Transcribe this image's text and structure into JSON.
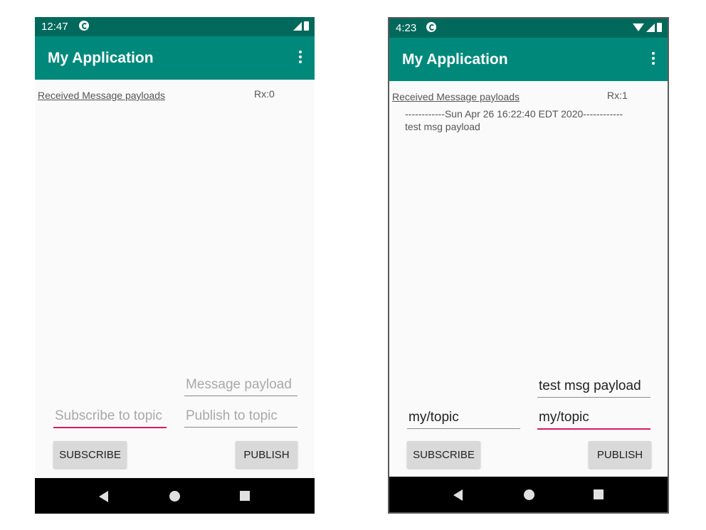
{
  "left": {
    "status_time": "12:47",
    "app_title": "My Application",
    "payloads_label": "Received Message payloads",
    "rx_count": "Rx:0",
    "message_payload_placeholder": "Message payload",
    "subscribe_topic_placeholder": "Subscribe to topic",
    "publish_topic_placeholder": "Publish to topic",
    "subscribe_label": "SUBSCRIBE",
    "publish_label": "PUBLISH"
  },
  "right": {
    "status_time": "4:23",
    "app_title": "My Application",
    "payloads_label": "Received Message payloads",
    "rx_count": "Rx:1",
    "messages": [
      {
        "header": "------------Sun Apr 26 16:22:40 EDT 2020------------",
        "body": "test msg payload"
      }
    ],
    "message_payload_value": "test msg payload",
    "subscribe_topic_value": "my/topic",
    "publish_topic_value": "my/topic",
    "subscribe_label": "SUBSCRIBE",
    "publish_label": "PUBLISH"
  },
  "colors": {
    "status_bar": "#00695c",
    "app_bar": "#00897b",
    "focus_underline": "#d81b60"
  },
  "icons": [
    "cast-icon",
    "wifi-icon",
    "signal-icon",
    "battery-icon",
    "overflow-menu-icon",
    "back-icon",
    "home-icon",
    "recents-icon"
  ]
}
